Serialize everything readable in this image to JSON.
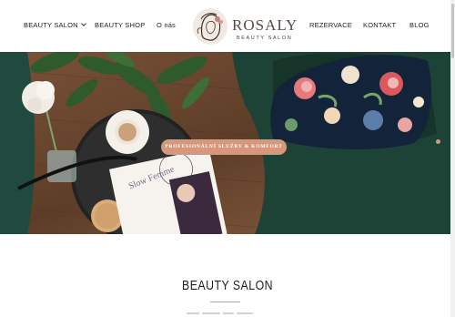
{
  "header": {
    "nav_left": [
      {
        "label": "BEAUTY SALON",
        "has_dropdown": true
      },
      {
        "label": "BEAUTY SHOP"
      },
      {
        "label": "O nás"
      }
    ],
    "nav_right": [
      {
        "label": "REZERVACE"
      },
      {
        "label": "KONTAKT"
      },
      {
        "label": "BLOG"
      }
    ],
    "logo": {
      "name": "ROSALY",
      "subtitle": "BEAUTY SALON"
    }
  },
  "hero": {
    "cta_label": "PROFESIONÁLNÍ SLUŽBY & KOMFORT",
    "magazine_title": "Slow Femme"
  },
  "section": {
    "title": "BEAUTY SALON"
  },
  "colors": {
    "accent": "#d7977b",
    "divider": "#c9a07f"
  }
}
